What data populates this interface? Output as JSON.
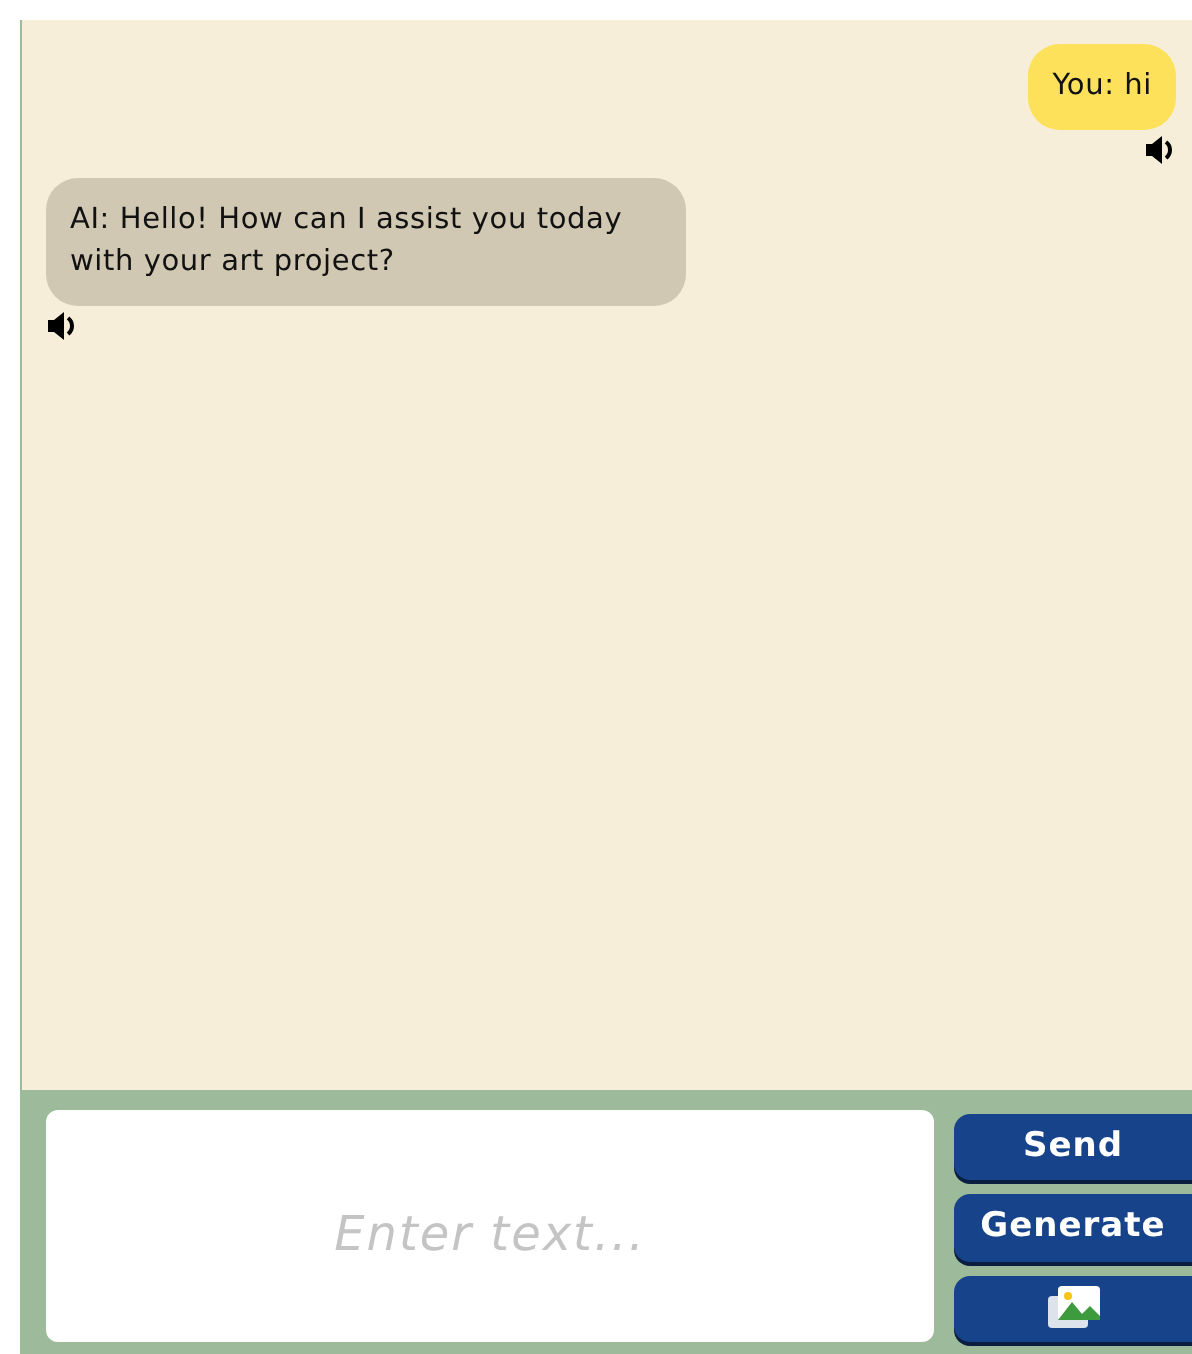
{
  "messages": [
    {
      "kind": "user",
      "text": "You: hi"
    },
    {
      "kind": "ai",
      "text": "AI: Hello! How can I assist you today with your art project?"
    }
  ],
  "input": {
    "placeholder": "Enter text..."
  },
  "buttons": [
    {
      "kind": "text",
      "label": "Send"
    },
    {
      "kind": "text",
      "label": "Generate"
    },
    {
      "kind": "image"
    }
  ]
}
